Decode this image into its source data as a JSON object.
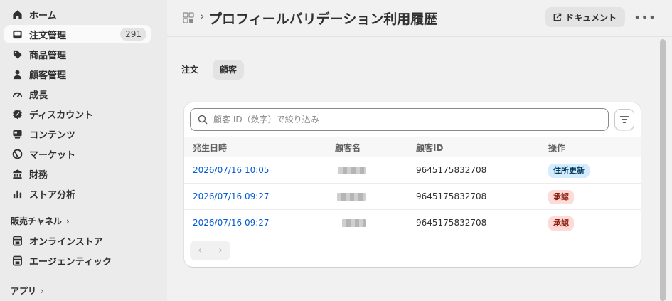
{
  "sidebar": {
    "items": [
      {
        "label": "ホーム",
        "icon": "home-icon"
      },
      {
        "label": "注文管理",
        "icon": "inbox-icon",
        "badge": "291"
      },
      {
        "label": "商品管理",
        "icon": "tag-icon"
      },
      {
        "label": "顧客管理",
        "icon": "person-icon"
      },
      {
        "label": "成長",
        "icon": "gauge-icon"
      },
      {
        "label": "ディスカウント",
        "icon": "discount-icon"
      },
      {
        "label": "コンテンツ",
        "icon": "content-icon"
      },
      {
        "label": "マーケット",
        "icon": "globe-icon"
      },
      {
        "label": "財務",
        "icon": "bank-icon"
      },
      {
        "label": "ストア分析",
        "icon": "bar-chart-icon"
      }
    ],
    "sales_channels_label": "販売チャネル",
    "channels": [
      {
        "label": "オンラインストア",
        "icon": "store-icon"
      },
      {
        "label": "エージェンティック",
        "icon": "store-icon"
      }
    ],
    "apps_label": "アプリ"
  },
  "header": {
    "title": "プロフィールバリデーション利用履歴",
    "doc_label": "ドキュメント",
    "more_label": "•••"
  },
  "tabs": [
    {
      "label": "注文",
      "selected": false
    },
    {
      "label": "顧客",
      "selected": true
    }
  ],
  "search": {
    "placeholder": "顧客 ID（数字）で絞り込み",
    "value": ""
  },
  "table": {
    "headers": [
      "発生日時",
      "顧客名",
      "顧客ID",
      "操作"
    ],
    "rows": [
      {
        "datetime": "2026/07/16 10:05",
        "customer_id": "9645175832708",
        "action": "住所更新",
        "tone": "info"
      },
      {
        "datetime": "2026/07/16 09:27",
        "customer_id": "9645175832708",
        "action": "承認",
        "tone": "critical"
      },
      {
        "datetime": "2026/07/16 09:27",
        "customer_id": "9645175832708",
        "action": "承認",
        "tone": "critical"
      }
    ]
  },
  "pagination": {
    "prev": "‹",
    "next": "›"
  },
  "colors": {
    "link": "#005bd3",
    "info_badge_bg": "#d5ebff",
    "critical_badge_bg": "#fedad9"
  }
}
